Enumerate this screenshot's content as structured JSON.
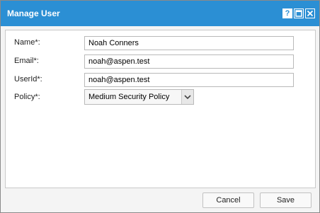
{
  "dialog": {
    "title": "Manage User",
    "help_label": "?",
    "maximize_icon": "maximize-icon",
    "close_icon": "close-icon"
  },
  "form": {
    "name": {
      "label": "Name*:",
      "value": "Noah Conners"
    },
    "email": {
      "label": "Email*:",
      "value": "noah@aspen.test"
    },
    "userid": {
      "label": "UserId*:",
      "value": "noah@aspen.test"
    },
    "policy": {
      "label": "Policy*:",
      "selected": "Medium Security Policy"
    }
  },
  "footer": {
    "cancel_label": "Cancel",
    "save_label": "Save"
  },
  "colors": {
    "titlebar": "#2b8fd4",
    "dialog_background": "#f4f4f4"
  }
}
